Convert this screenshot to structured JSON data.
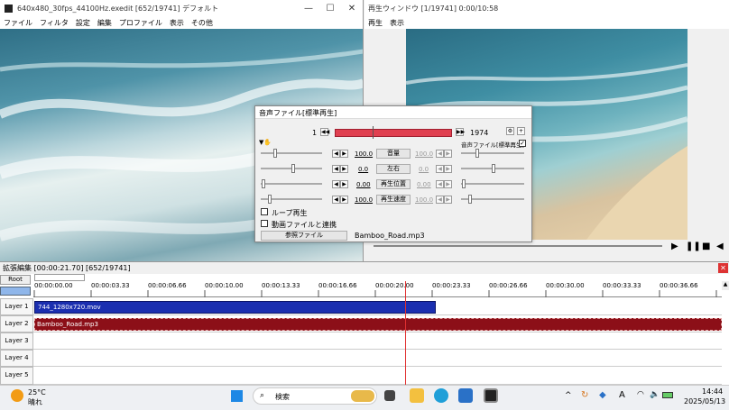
{
  "editor": {
    "title": "640x480_30fps_44100Hz.exedit  [652/19741]  デフォルト",
    "menu": [
      "ファイル",
      "フィルタ",
      "設定",
      "編集",
      "プロファイル",
      "表示",
      "その他"
    ]
  },
  "player": {
    "title": "再生ウィンドウ  [1/19741]  0:00/10:58",
    "menu": [
      "再生",
      "表示"
    ]
  },
  "audio": {
    "title": "音声ファイル[標準再生]",
    "frame_start": "1",
    "frame_end": "1974",
    "sync_label": "音声ファイル[標準再生]",
    "rows": [
      {
        "left": "100.0",
        "label": "音量",
        "right": "100.0"
      },
      {
        "left": "0.0",
        "label": "左右",
        "right": "0.0"
      },
      {
        "left": "0.00",
        "label": "再生位置",
        "right": "0.00"
      },
      {
        "left": "100.0",
        "label": "再生速度",
        "right": "100.0"
      }
    ],
    "loop_label": "ループ再生",
    "link_label": "動画ファイルと連携",
    "ref_button": "参照ファイル",
    "file_name": "Bamboo_Road.mp3"
  },
  "timeline": {
    "title": "拡張編集 [00:00:21.70] [652/19741]",
    "root_label": "Root",
    "ruler": [
      "00:00:00.00",
      "00:00:03.33",
      "00:00:06.66",
      "00:00:10.00",
      "00:00:13.33",
      "00:00:16.66",
      "00:00:20.00",
      "00:00:23.33",
      "00:00:26.66",
      "00:00:30.00",
      "00:00:33.33",
      "00:00:36.66"
    ],
    "layers": [
      "Layer 1",
      "Layer 2",
      "Layer 3",
      "Layer 4",
      "Layer 5"
    ],
    "clip_video": "744_1280x720.mov",
    "clip_audio": "Bamboo_Road.mp3",
    "video_color": "#1b2fb0",
    "audio_color": "#8c0f18",
    "playhead_color": "#e03030"
  },
  "taskbar": {
    "temp": "25°C",
    "weather": "晴れ",
    "search_placeholder": "検索",
    "time": "14:44",
    "date": "2025/05/13"
  }
}
